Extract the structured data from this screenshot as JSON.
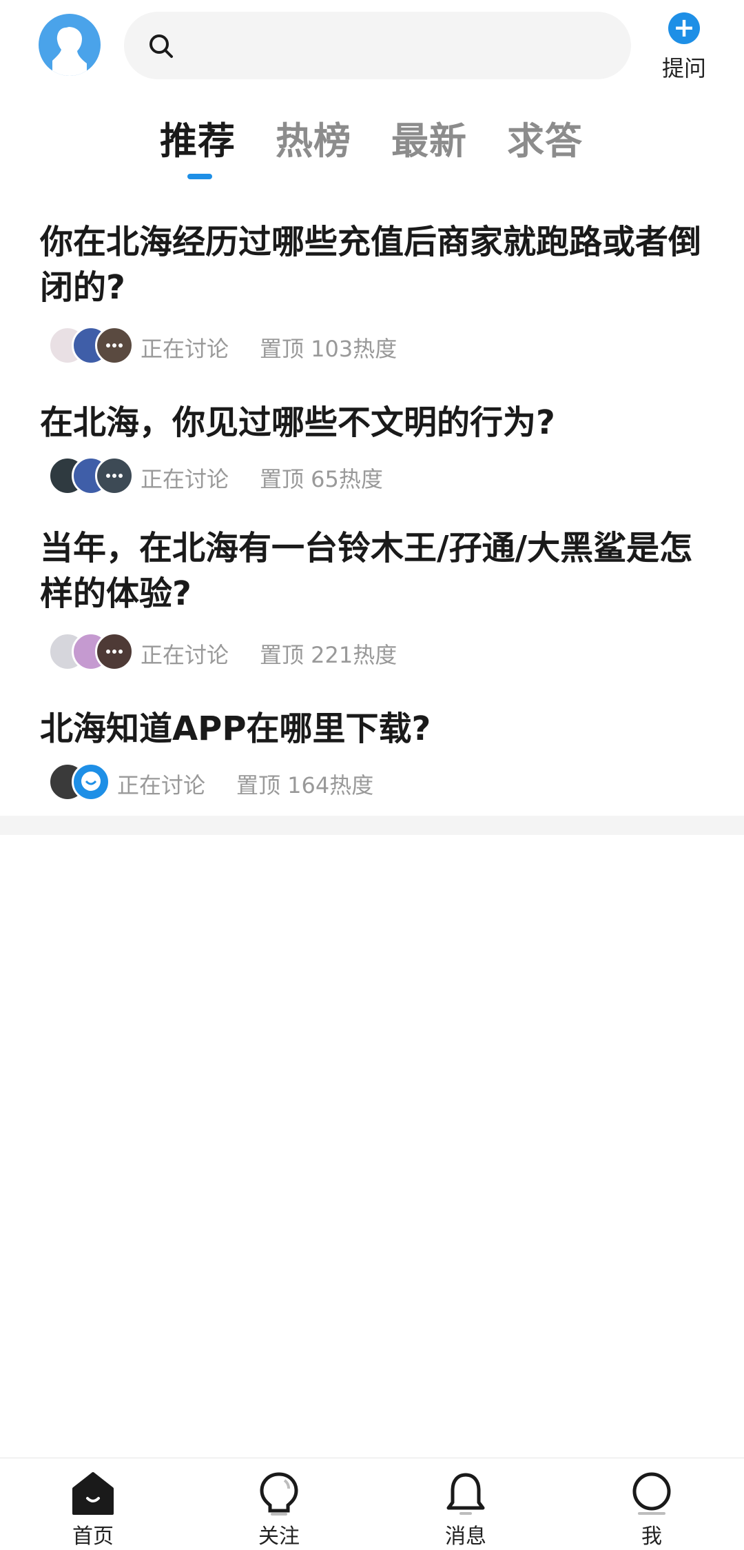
{
  "header": {
    "search_placeholder": "",
    "ask_label": "提问"
  },
  "tabs": [
    {
      "label": "推荐",
      "active": true
    },
    {
      "label": "热榜",
      "active": false
    },
    {
      "label": "最新",
      "active": false
    },
    {
      "label": "求答",
      "active": false
    }
  ],
  "questions": [
    {
      "title": "你在北海经历过哪些充值后商家就跑路或者倒闭的?",
      "status": "正在讨论",
      "stats": "置顶 103热度"
    },
    {
      "title": "在北海，你见过哪些不文明的行为?",
      "status": "正在讨论",
      "stats": "置顶 65热度"
    },
    {
      "title": "当年，在北海有一台铃木王/孖通/大黑鲨是怎样的体验?",
      "status": "正在讨论",
      "stats": "置顶 221热度"
    },
    {
      "title": "北海知道APP在哪里下载?",
      "status": "正在讨论",
      "stats": "置顶 164热度"
    }
  ],
  "bottom_nav": [
    {
      "label": "首页",
      "icon": "home-icon",
      "active": true
    },
    {
      "label": "关注",
      "icon": "bulb-icon",
      "active": false
    },
    {
      "label": "消息",
      "icon": "bell-icon",
      "active": false
    },
    {
      "label": "我",
      "icon": "profile-icon",
      "active": false
    }
  ],
  "colors": {
    "accent": "#1e8fe6",
    "muted": "#999999",
    "avatar_bg": "#4aa3ea"
  }
}
